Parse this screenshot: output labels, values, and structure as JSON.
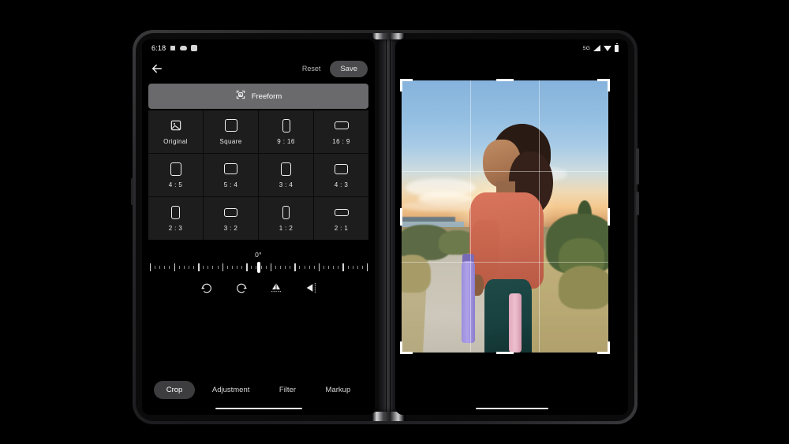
{
  "device": {
    "type": "foldable-dual-screen-phone",
    "hinge_label": "center-hinge"
  },
  "left_screen": {
    "status_bar": {
      "time": "6:18",
      "notification_icons": [
        "camera-icon",
        "cloud-icon",
        "volume-icon"
      ]
    },
    "app_bar": {
      "back_icon": "back-arrow-icon",
      "reset_label": "Reset",
      "save_label": "Save"
    },
    "freeform": {
      "label": "Freeform",
      "icon": "crop-photo-icon",
      "selected": true
    },
    "aspect_ratios": [
      {
        "label": "Original",
        "shape": "image",
        "w": 17,
        "h": 14
      },
      {
        "label": "Square",
        "shape": "rect",
        "w": 14,
        "h": 14
      },
      {
        "label": "9 : 16",
        "shape": "rect",
        "w": 8,
        "h": 15
      },
      {
        "label": "16 : 9",
        "shape": "rect",
        "w": 16,
        "h": 8
      },
      {
        "label": "4 : 5",
        "shape": "rect",
        "w": 12,
        "h": 15
      },
      {
        "label": "5 : 4",
        "shape": "rect",
        "w": 15,
        "h": 12
      },
      {
        "label": "3 : 4",
        "shape": "rect",
        "w": 11,
        "h": 15
      },
      {
        "label": "4 : 3",
        "shape": "rect",
        "w": 15,
        "h": 11
      },
      {
        "label": "2 : 3",
        "shape": "rect",
        "w": 9,
        "h": 15
      },
      {
        "label": "3 : 2",
        "shape": "rect",
        "w": 15,
        "h": 9
      },
      {
        "label": "1 : 2",
        "shape": "rect",
        "w": 7,
        "h": 15
      },
      {
        "label": "2 : 1",
        "shape": "rect",
        "w": 16,
        "h": 7
      }
    ],
    "rotation": {
      "angle_label": "0°",
      "angle_value": 0,
      "range_min": -45,
      "range_max": 45
    },
    "rotate_tools": [
      {
        "name": "rotate-left-icon"
      },
      {
        "name": "rotate-right-icon"
      },
      {
        "name": "flip-vertical-icon"
      },
      {
        "name": "flip-horizontal-icon"
      }
    ],
    "tabs": [
      {
        "label": "Crop",
        "active": true
      },
      {
        "label": "Adjustment",
        "active": false
      },
      {
        "label": "Filter",
        "active": false
      },
      {
        "label": "Markup",
        "active": false
      }
    ]
  },
  "right_screen": {
    "status_bar": {
      "network": "5G",
      "icons": [
        "signal-icon",
        "wifi-icon",
        "battery-icon"
      ]
    },
    "photo": {
      "description": "Woman in coral sweatshirt walking on a dirt path at sunset carrying a purple water bottle and pink yoga mat",
      "crop_handles_visible": true,
      "grid_lines": "rule-of-thirds"
    }
  },
  "colors": {
    "accent_sweatshirt": "#cc6a52",
    "leggings": "#17403e",
    "bottle": "#a294e3",
    "mat": "#e5b0c2",
    "save_button_bg": "#4a4a4c",
    "freeform_bg": "#6a6a6c",
    "cell_bg": "#1d1d1e",
    "active_tab_bg": "#3d3d3f"
  }
}
